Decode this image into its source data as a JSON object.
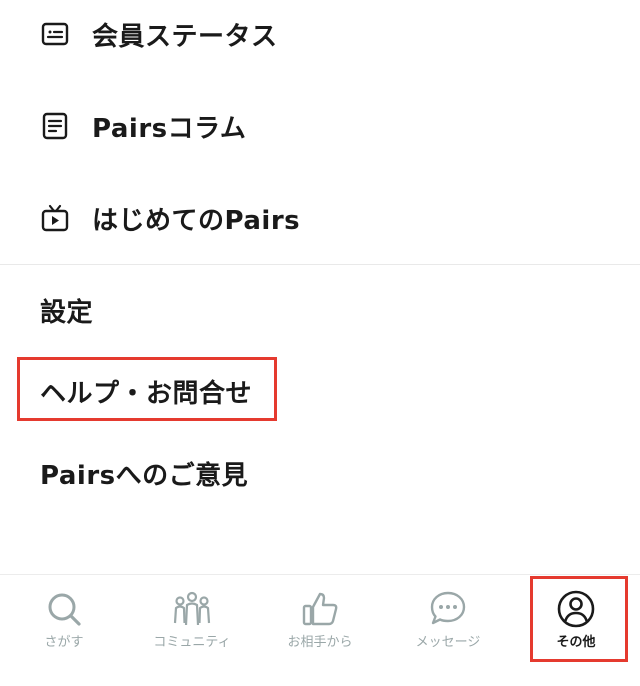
{
  "menu": {
    "items": [
      {
        "label": "会員ステータス",
        "icon": "member-card-icon"
      },
      {
        "label": "Pairsコラム",
        "icon": "document-icon"
      },
      {
        "label": "はじめてのPairs",
        "icon": "tv-play-icon"
      }
    ],
    "settings_label": "設定",
    "help_label": "ヘルプ・お問合せ",
    "feedback_label": "Pairsへのご意見"
  },
  "tabbar": {
    "tabs": [
      {
        "label": "さがす",
        "icon": "search-icon"
      },
      {
        "label": "コミュニティ",
        "icon": "community-icon"
      },
      {
        "label": "お相手から",
        "icon": "thumbs-up-icon"
      },
      {
        "label": "メッセージ",
        "icon": "message-icon"
      },
      {
        "label": "その他",
        "icon": "profile-icon"
      }
    ],
    "active_index": 4
  },
  "colors": {
    "text": "#1a1a1a",
    "inactive_tab": "#9aa7a8",
    "highlight_border": "#e53a2f"
  }
}
